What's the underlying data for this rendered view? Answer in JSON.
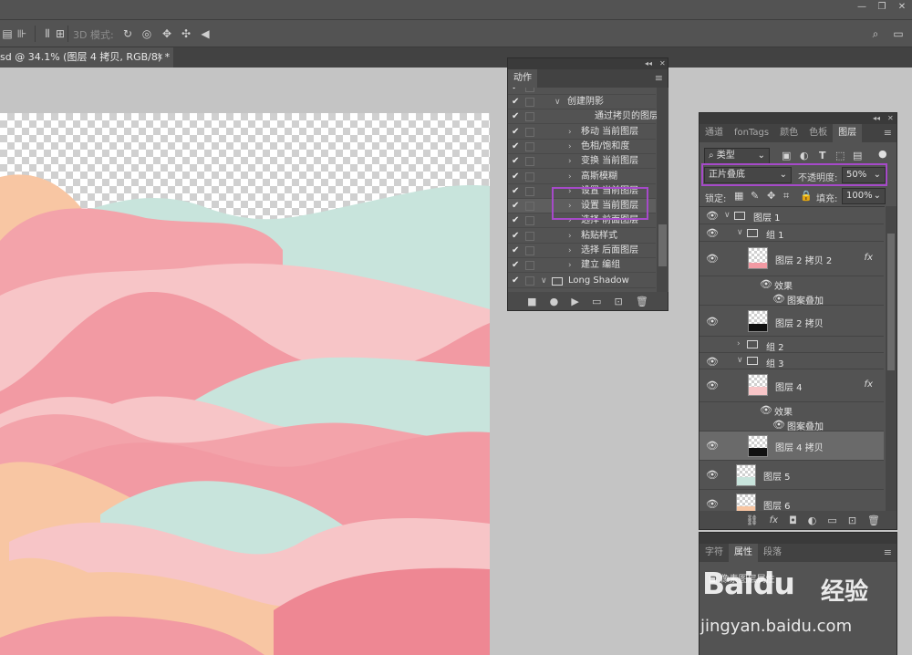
{
  "window": {
    "minimize": "—",
    "restore": "❐",
    "close": "✕"
  },
  "options": {
    "mode3d_label": "3D 模式:",
    "search_icon": "search-icon",
    "workspace_icon": "workspace-icon"
  },
  "document": {
    "tab_title": "sd @ 34.1% (图层 4 拷贝, RGB/8) *",
    "tab_close": "×"
  },
  "actions_panel": {
    "tab": "动作",
    "rows": [
      {
        "checked": true,
        "indent": 1,
        "arrow": "∨",
        "label": "创建阴影",
        "folder": false
      },
      {
        "checked": true,
        "indent": 3,
        "arrow": "",
        "label": "通过拷贝的图层"
      },
      {
        "checked": true,
        "indent": 2,
        "arrow": "›",
        "label": "移动 当前图层"
      },
      {
        "checked": true,
        "indent": 2,
        "arrow": "›",
        "label": "色相/饱和度"
      },
      {
        "checked": true,
        "indent": 2,
        "arrow": "›",
        "label": "变换 当前图层"
      },
      {
        "checked": true,
        "indent": 2,
        "arrow": "›",
        "label": "高斯模糊"
      },
      {
        "checked": true,
        "indent": 2,
        "arrow": "›",
        "label": "设置 当前图层"
      },
      {
        "checked": true,
        "indent": 2,
        "arrow": "›",
        "label": "设置 当前图层"
      },
      {
        "checked": true,
        "indent": 2,
        "arrow": "›",
        "label": "选择 前面图层"
      },
      {
        "checked": true,
        "indent": 2,
        "arrow": "›",
        "label": "粘贴样式"
      },
      {
        "checked": true,
        "indent": 2,
        "arrow": "›",
        "label": "选择 后面图层"
      },
      {
        "checked": true,
        "indent": 2,
        "arrow": "›",
        "label": "建立 编组"
      },
      {
        "checked": true,
        "indent": 0,
        "arrow": "∨",
        "label": "Long Shadow",
        "folder": true
      }
    ],
    "bottom_buttons": [
      "stop-icon",
      "record-icon",
      "play-icon",
      "new-set-icon",
      "new-action-icon",
      "trash-icon"
    ]
  },
  "layers_panel": {
    "tabs": [
      "通道",
      "fonTags",
      "颜色",
      "色板",
      "图层"
    ],
    "active_tab": "图层",
    "filter_label": "类型",
    "blend_mode": "正片叠底",
    "opacity_label": "不透明度:",
    "opacity_value": "50%",
    "lock_label": "锁定:",
    "fill_label": "填充:",
    "fill_value": "100%",
    "effects_label": "效果",
    "pattern_overlay": "图案叠加",
    "group_layer1": "图层 1",
    "group1": "组 1",
    "layer2copy2": "图层 2 拷贝 2",
    "layer2copy": "图层 2 拷贝",
    "group2": "组 2",
    "group3": "组 3",
    "layer4": "图层 4",
    "layer4copy": "图层 4 拷贝",
    "layer5": "图层 5",
    "layer6": "图层 6",
    "fx": "fx"
  },
  "props_panel": {
    "tabs": [
      "字符",
      "属性",
      "段落"
    ],
    "active_tab": "属性",
    "title": "像素图层属性"
  },
  "watermark": {
    "logo": "Baidu",
    "brand": "经验",
    "url": "jingyan.baidu.com"
  },
  "colors": {
    "peach": "#f8c6a3",
    "mint": "#c8e4dc",
    "pink_light": "#f7c5c7",
    "pink": "#f29aa3",
    "pink_dark": "#ee8793",
    "highlight": "#a64ac9"
  }
}
